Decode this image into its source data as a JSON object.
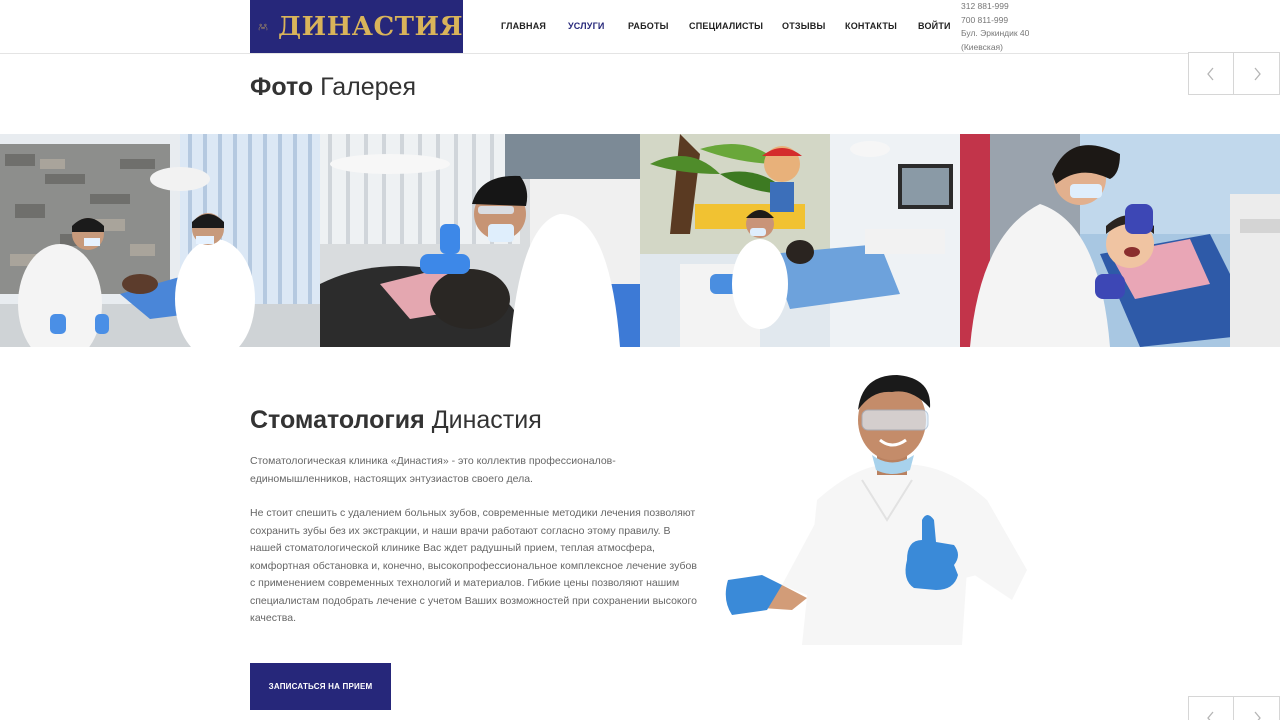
{
  "header": {
    "logo_text": "ДИНАСТИЯ",
    "nav": [
      {
        "label": "ГЛАВНАЯ"
      },
      {
        "label": "УСЛУГИ"
      },
      {
        "label": "РАБОТЫ"
      },
      {
        "label": "СПЕЦИАЛИСТЫ"
      },
      {
        "label": "ОТЗЫВЫ"
      },
      {
        "label": "КОНТАКТЫ"
      },
      {
        "label": "ВОЙТИ"
      }
    ],
    "active_nav": "УСЛУГИ",
    "contact": {
      "phone1": "312 881-999",
      "phone2": "700 811-999",
      "address1": "Бул. Эркиндик 40",
      "address2": "(Киевская)"
    }
  },
  "gallery": {
    "title_bold": "Фото",
    "title_light": "Галерея",
    "photos": [
      {
        "icon": "dentists-treating-patient-photo"
      },
      {
        "icon": "dentist-closeup-photo"
      },
      {
        "icon": "kids-room-treatment-photo"
      },
      {
        "icon": "child-patient-photo"
      }
    ]
  },
  "about": {
    "title_bold": "Стоматология",
    "title_light": "Династия",
    "paragraph1": "Стоматологическая клиника «Династия» - это коллектив профессионалов-единомышленников, настоящих энтузиастов своего дела.",
    "paragraph2": "Не стоит спешить с удалением больных зубов, современные методики лечения позволяют сохранить зубы без их экстракции, и наши врачи работают согласно этому правилу. В нашей стоматологической клинике Вас ждет радушный прием, теплая атмосфера, комфортная обстановка и, конечно, высокопрофессиональное комплексное лечение зубов с применением современных технологий и материалов. Гибкие цены позволяют нашим специалистам подобрать лечение с учетом Ваших возможностей при сохранении высокого качества.",
    "cta_label": "ЗАПИСАТЬСЯ НА ПРИЕМ"
  },
  "colors": {
    "brand": "#26277a",
    "logo_gold": "#d9b45a"
  }
}
